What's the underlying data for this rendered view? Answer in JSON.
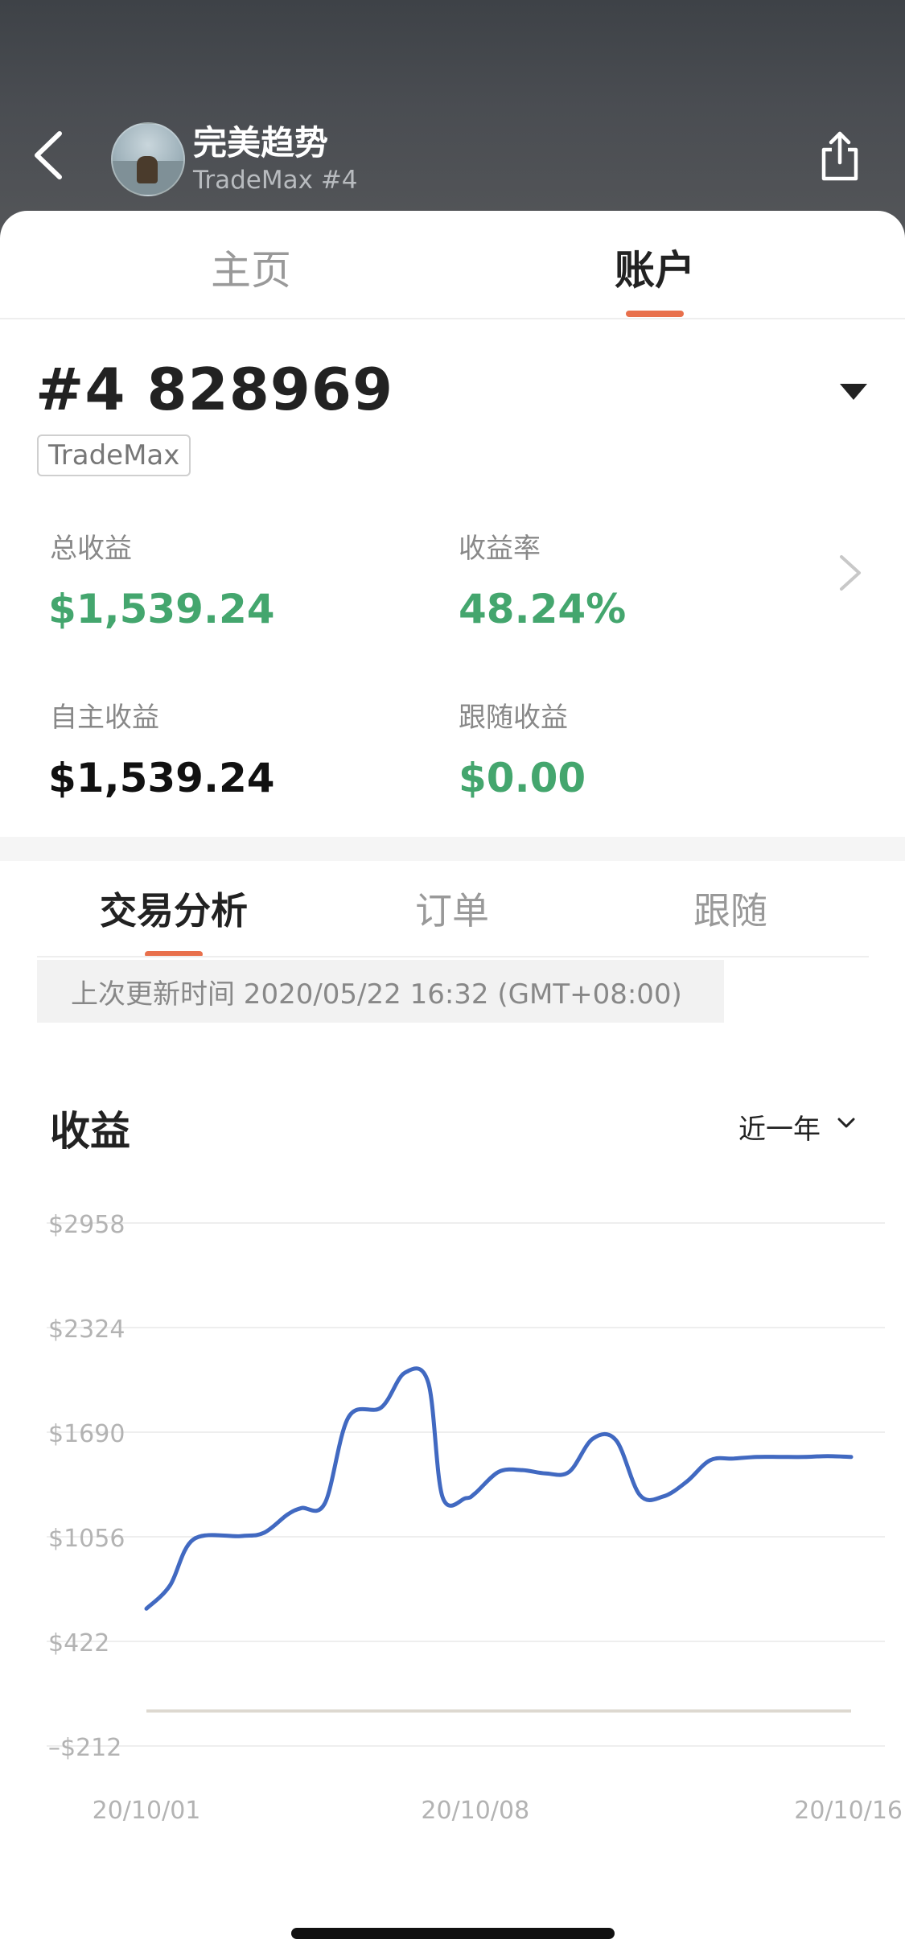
{
  "header": {
    "title": "完美趋势",
    "subtitle": "TradeMax #4"
  },
  "top_tabs": [
    {
      "label": "主页",
      "active": false
    },
    {
      "label": "账户",
      "active": true
    }
  ],
  "account": {
    "id": "#4 828969",
    "broker_tag": "TradeMax"
  },
  "stats": {
    "total_profit_label": "总收益",
    "total_profit_value": "$1,539.24",
    "return_rate_label": "收益率",
    "return_rate_value": "48.24%",
    "self_profit_label": "自主收益",
    "self_profit_value": "$1,539.24",
    "follow_profit_label": "跟随收益",
    "follow_profit_value": "$0.00"
  },
  "sub_tabs": [
    {
      "label": "交易分析",
      "active": true
    },
    {
      "label": "订单",
      "active": false
    },
    {
      "label": "跟随",
      "active": false
    }
  ],
  "last_update": "上次更新时间 2020/05/22 16:32 (GMT+08:00)",
  "chart_section": {
    "title": "收益",
    "range": "近一年"
  },
  "colors": {
    "accent": "#e8704c",
    "positive": "#44a66e",
    "line": "#4169c1",
    "baseline": "#ddd8d0"
  },
  "icons": {
    "back": "chevron-left-icon",
    "share": "share-icon",
    "dropdown": "caret-down-icon",
    "detail": "chevron-right-icon",
    "range": "chevron-down-icon"
  },
  "chart_data": {
    "type": "line",
    "ylim": [
      -212,
      2958
    ],
    "y_ticks": [
      2958,
      2324,
      1690,
      1056,
      422,
      -212
    ],
    "y_tick_labels": [
      "$2958",
      "$2324",
      "$1690",
      "$1056",
      "$422",
      "–$212"
    ],
    "x_tick_labels": [
      "20/10/01",
      "20/10/08",
      "20/10/16"
    ],
    "x_domain": [
      0,
      15
    ],
    "x_tick_positions": [
      0,
      7,
      15
    ],
    "grid": true,
    "series": [
      {
        "x": [
          0,
          0.5,
          1,
          2,
          2.5,
          3,
          3.3,
          3.8,
          4.3,
          5,
          5.5,
          6,
          6.3,
          6.8,
          7,
          7.5,
          8,
          8.5,
          9,
          9.5,
          10,
          10.5,
          11,
          11.5,
          12,
          12.5,
          13,
          13.5,
          14,
          14.5,
          15
        ],
        "values": [
          620,
          760,
          1040,
          1060,
          1080,
          1190,
          1230,
          1260,
          1780,
          1840,
          2050,
          1990,
          1300,
          1290,
          1320,
          1450,
          1460,
          1440,
          1450,
          1650,
          1640,
          1310,
          1300,
          1390,
          1520,
          1530,
          1540,
          1540,
          1540,
          1545,
          1540
        ]
      }
    ],
    "baseline_value": 0
  }
}
